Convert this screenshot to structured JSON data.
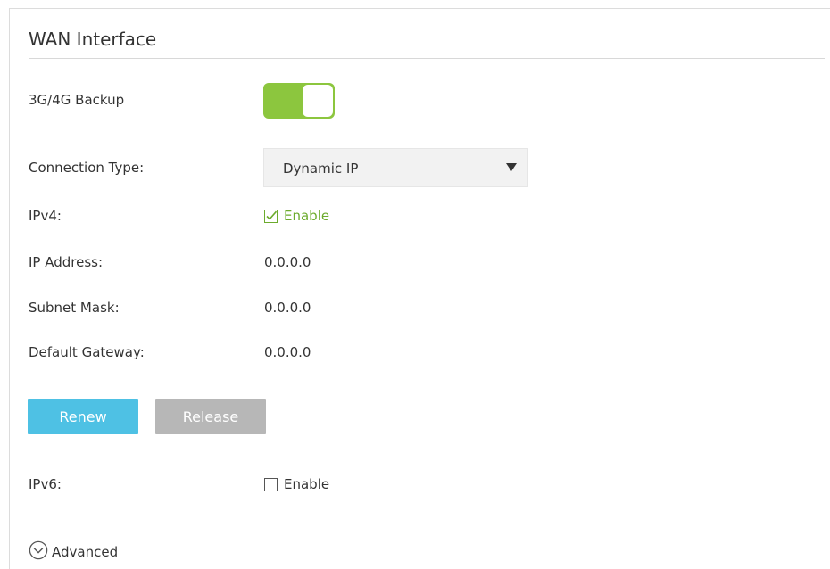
{
  "section": {
    "title": "WAN Interface"
  },
  "backup": {
    "label": "3G/4G Backup",
    "enabled": true
  },
  "connection": {
    "label": "Connection Type:",
    "selected": "Dynamic IP"
  },
  "ipv4": {
    "label": "IPv4:",
    "checkbox_label": "Enable",
    "checked": true
  },
  "fields": {
    "ip_address": {
      "label": "IP Address:",
      "value": "0.0.0.0"
    },
    "subnet_mask": {
      "label": "Subnet Mask:",
      "value": "0.0.0.0"
    },
    "default_gateway": {
      "label": "Default Gateway:",
      "value": "0.0.0.0"
    }
  },
  "buttons": {
    "renew": "Renew",
    "release": "Release"
  },
  "ipv6": {
    "label": "IPv6:",
    "checkbox_label": "Enable",
    "checked": false
  },
  "advanced": {
    "label": "Advanced"
  },
  "colors": {
    "toggle_on": "#8cc63e",
    "checked_green": "#6cab2d",
    "renew_button": "#4ec1e4",
    "release_button": "#b7b7b7"
  },
  "icons": {
    "ipv4_checkbox": "checkbox-checked-icon",
    "ipv6_checkbox": "checkbox-unchecked-icon",
    "advanced": "chevron-down-circle-icon",
    "select_caret": "caret-down-icon"
  }
}
